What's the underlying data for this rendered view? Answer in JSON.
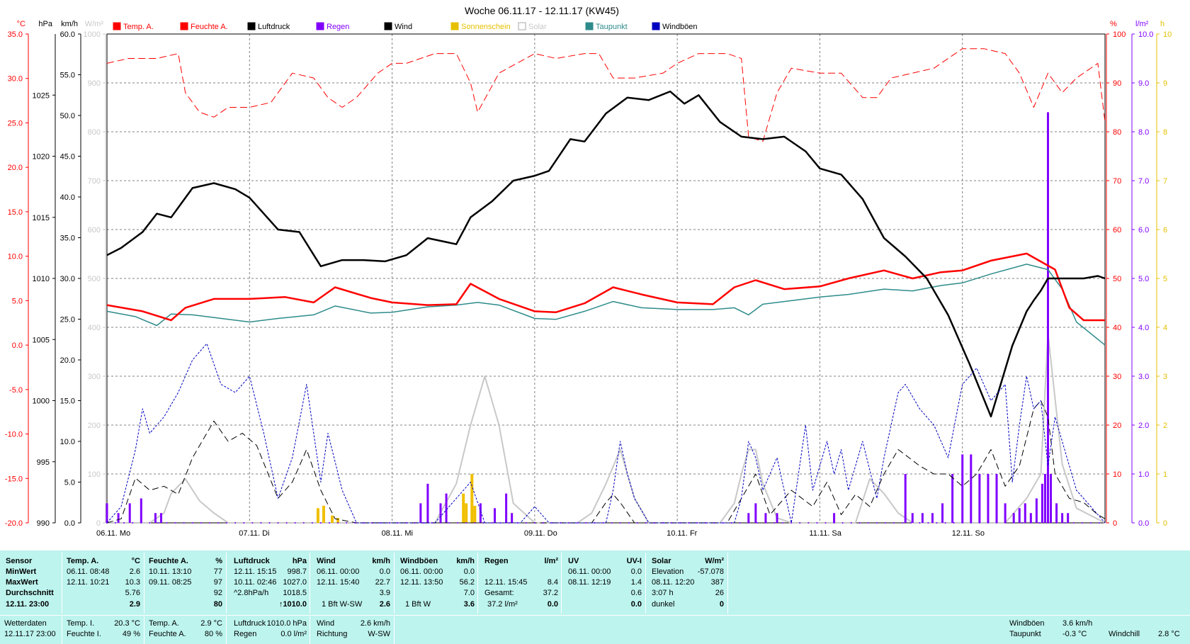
{
  "chart_data": {
    "type": "line",
    "title": "Woche 06.11.17 - 12.11.17 (KW45)",
    "x_days": [
      "06.11. Mo",
      "07.11. Di",
      "08.11. Mi",
      "09.11. Do",
      "10.11. Fr",
      "11.11. Sa",
      "12.11. So"
    ],
    "legend": [
      {
        "name": "Temp. A.",
        "color": "#ff0000"
      },
      {
        "name": "Feuchte A.",
        "color": "#ff0000"
      },
      {
        "name": "Luftdruck",
        "color": "#000000"
      },
      {
        "name": "Regen",
        "color": "#8000ff"
      },
      {
        "name": "Wind",
        "color": "#000000"
      },
      {
        "name": "Sonnenschein",
        "color": "#e6c000"
      },
      {
        "name": "Solar",
        "color": "#c8c8c8"
      },
      {
        "name": "Taupunkt",
        "color": "#2e8b8b"
      },
      {
        "name": "Windböen",
        "color": "#0000c0"
      }
    ],
    "axes": {
      "temp": {
        "unit": "°C",
        "min": -20,
        "max": 35,
        "ticks": [
          "35.0",
          "30.0",
          "25.0",
          "20.0",
          "15.0",
          "10.0",
          "5.0",
          "0.0",
          "-5.0",
          "-10.0",
          "-15.0",
          "-20.0"
        ]
      },
      "pressure": {
        "unit": "hPa",
        "min": 990,
        "max": 1030,
        "ticks": [
          "1025",
          "1020",
          "1015",
          "1010",
          "1005",
          "1000",
          "995",
          "990"
        ]
      },
      "wind": {
        "unit": "km/h",
        "min": 0,
        "max": 60,
        "ticks": [
          "60.0",
          "55.0",
          "50.0",
          "45.0",
          "40.0",
          "35.0",
          "30.0",
          "25.0",
          "20.0",
          "15.0",
          "10.0",
          "5.0",
          "0.0"
        ]
      },
      "solar": {
        "unit": "W/m²",
        "min": 0,
        "max": 1000,
        "ticks": [
          "1000",
          "900",
          "800",
          "700",
          "600",
          "500",
          "400",
          "300",
          "200",
          "100",
          "0"
        ]
      },
      "humidity": {
        "unit": "%",
        "min": 0,
        "max": 100,
        "ticks": [
          "100",
          "90",
          "80",
          "70",
          "60",
          "50",
          "40",
          "30",
          "20",
          "10",
          "0"
        ]
      },
      "rain": {
        "unit": "l/m²",
        "min": 0,
        "max": 10,
        "ticks": [
          "10.0",
          "9.0",
          "8.0",
          "7.0",
          "6.0",
          "5.0",
          "4.0",
          "3.0",
          "2.0",
          "1.0",
          "0.0"
        ]
      },
      "sun": {
        "unit": "h",
        "min": 0,
        "max": 10,
        "ticks": [
          "10",
          "9",
          "8",
          "7",
          "6",
          "5",
          "4",
          "3",
          "2",
          "1",
          "0"
        ]
      }
    },
    "series": [
      {
        "name": "Temp. A.",
        "axis": "temp",
        "x": [
          0,
          0.25,
          0.45,
          0.55,
          0.75,
          1,
          1.25,
          1.45,
          1.6,
          1.85,
          2,
          2.25,
          2.45,
          2.55,
          2.75,
          3,
          3.15,
          3.35,
          3.55,
          3.75,
          4,
          4.25,
          4.4,
          4.55,
          4.75,
          5,
          5.2,
          5.45,
          5.65,
          5.85,
          6,
          6.2,
          6.45,
          6.65,
          6.75,
          6.85,
          7
        ],
        "y": [
          4.5,
          3.8,
          2.8,
          4.2,
          5.2,
          5.2,
          5.4,
          4.8,
          6.5,
          5.3,
          4.8,
          4.5,
          4.6,
          6.9,
          5.2,
          3.8,
          3.7,
          4.7,
          6.5,
          5.7,
          4.8,
          4.6,
          6.5,
          7.3,
          6.3,
          6.6,
          7.5,
          8.4,
          7.5,
          8.2,
          8.4,
          9.5,
          10.3,
          8.5,
          4.2,
          2.8,
          2.8
        ]
      },
      {
        "name": "Taupunkt",
        "axis": "temp",
        "x": [
          0,
          0.2,
          0.35,
          0.45,
          0.6,
          1,
          1.2,
          1.45,
          1.6,
          1.85,
          2,
          2.25,
          2.45,
          2.6,
          2.75,
          3,
          3.15,
          3.35,
          3.55,
          3.75,
          4,
          4.25,
          4.4,
          4.5,
          4.6,
          5,
          5.2,
          5.45,
          5.65,
          5.85,
          6,
          6.2,
          6.45,
          6.6,
          6.7,
          6.8,
          7
        ],
        "y": [
          3.8,
          3.2,
          2.2,
          3.5,
          3.4,
          2.6,
          3.0,
          3.4,
          4.4,
          3.6,
          3.7,
          4.3,
          4.5,
          4.8,
          4.5,
          3.0,
          2.9,
          3.8,
          4.9,
          4.2,
          4.0,
          4.0,
          4.2,
          3.4,
          4.6,
          5.4,
          5.7,
          6.3,
          6.1,
          6.7,
          7.0,
          8.0,
          9.1,
          8.5,
          6.3,
          2.6,
          0.0
        ]
      },
      {
        "name": "Feuchte A.",
        "axis": "humidity",
        "x": [
          0,
          0.15,
          0.35,
          0.5,
          0.55,
          0.65,
          0.75,
          0.85,
          1,
          1.15,
          1.3,
          1.45,
          1.55,
          1.65,
          1.75,
          1.9,
          2,
          2.1,
          2.3,
          2.45,
          2.55,
          2.6,
          2.75,
          3,
          3.15,
          3.35,
          3.45,
          3.55,
          3.7,
          3.9,
          4,
          4.15,
          4.35,
          4.45,
          4.5,
          4.6,
          4.7,
          4.8,
          5,
          5.15,
          5.3,
          5.4,
          5.5,
          5.65,
          5.8,
          6,
          6.15,
          6.3,
          6.4,
          6.5,
          6.6,
          6.7,
          6.8,
          6.95,
          7
        ],
        "y": [
          94,
          95,
          95,
          96,
          88,
          84,
          83,
          85,
          85,
          86,
          92,
          91,
          87,
          85,
          87,
          92,
          94,
          94,
          96,
          96,
          90,
          84,
          92,
          96,
          95,
          96,
          96,
          91,
          91,
          92,
          94,
          96,
          96,
          95,
          79,
          78,
          88,
          93,
          92,
          92,
          87,
          87,
          91,
          92,
          93,
          97,
          97,
          96,
          92,
          85,
          92,
          88,
          91,
          94,
          82
        ]
      },
      {
        "name": "Luftdruck",
        "axis": "pressure",
        "x": [
          0,
          0.1,
          0.25,
          0.35,
          0.45,
          0.6,
          0.75,
          0.9,
          1,
          1.2,
          1.35,
          1.5,
          1.65,
          1.8,
          1.95,
          2.1,
          2.25,
          2.45,
          2.55,
          2.7,
          2.85,
          3,
          3.1,
          3.25,
          3.35,
          3.5,
          3.65,
          3.8,
          3.95,
          4.05,
          4.15,
          4.3,
          4.45,
          4.6,
          4.75,
          4.9,
          5,
          5.15,
          5.3,
          5.45,
          5.6,
          5.75,
          5.9,
          6.05,
          6.2,
          6.35,
          6.45,
          6.5,
          6.55,
          6.6,
          6.7,
          6.85,
          6.95,
          7
        ],
        "y": [
          1011.9,
          1012.5,
          1013.8,
          1015.3,
          1015.0,
          1017.4,
          1017.8,
          1017.3,
          1016.6,
          1014.0,
          1013.8,
          1011.0,
          1011.5,
          1011.5,
          1011.4,
          1011.9,
          1013.3,
          1012.8,
          1015.0,
          1016.3,
          1018.0,
          1018.4,
          1018.8,
          1021.4,
          1021.2,
          1023.5,
          1024.8,
          1024.6,
          1025.3,
          1024.3,
          1025.0,
          1022.8,
          1021.6,
          1021.4,
          1021.6,
          1020.4,
          1019.0,
          1018.5,
          1016.5,
          1013.3,
          1011.8,
          1010.0,
          1007.0,
          1003.0,
          998.7,
          1004.5,
          1007.3,
          1008.2,
          1009.0,
          1010.0,
          1010.0,
          1010.0,
          1010.2,
          1010.0
        ],
        "note": "approximate"
      },
      {
        "name": "Wind",
        "axis": "wind",
        "x": [
          0,
          0.1,
          0.2,
          0.3,
          0.4,
          0.5,
          0.6,
          0.75,
          0.85,
          0.95,
          1.05,
          1.2,
          1.3,
          1.4,
          1.5,
          1.6,
          1.75,
          1.9,
          2,
          2.1,
          2.3,
          2.45,
          2.6,
          2.75,
          2.9,
          3.0,
          3.1,
          3.2,
          3.4,
          3.5,
          3.55,
          3.6,
          3.7,
          3.8,
          3.9,
          4,
          4.2,
          4.35,
          4.45,
          4.55,
          4.65,
          4.8,
          4.95,
          5.05,
          5.15,
          5.25,
          5.35,
          5.45,
          5.55,
          5.7,
          5.8,
          5.9,
          6,
          6.1,
          6.2,
          6.3,
          6.4,
          6.45,
          6.5,
          6.55,
          6.6,
          6.65,
          6.75,
          6.85,
          6.95,
          7
        ],
        "y": [
          0,
          0.5,
          5.5,
          4,
          4.5,
          3.5,
          8,
          12.5,
          10,
          11,
          9.5,
          3,
          5,
          9,
          4,
          0.5,
          0,
          0,
          0,
          0,
          0,
          0,
          0,
          0,
          0,
          0,
          0,
          0,
          0,
          2.5,
          3.5,
          2.5,
          0,
          0,
          0,
          0,
          0,
          0,
          3,
          6,
          1,
          4,
          2,
          5,
          1,
          3.5,
          2,
          6,
          9,
          7,
          6,
          6,
          4.5,
          6,
          9,
          4.5,
          7,
          10.5,
          14,
          15,
          13,
          6,
          3,
          2.5,
          1,
          0.5
        ]
      },
      {
        "name": "Windböen",
        "axis": "wind",
        "x": [
          0,
          0.1,
          0.2,
          0.25,
          0.3,
          0.4,
          0.5,
          0.6,
          0.7,
          0.8,
          0.9,
          1,
          1.1,
          1.2,
          1.3,
          1.4,
          1.5,
          1.55,
          1.65,
          1.75,
          1.9,
          2,
          2.3,
          2.45,
          2.55,
          2.65,
          2.75,
          2.9,
          3,
          3.1,
          3.3,
          3.4,
          3.5,
          3.55,
          3.6,
          3.65,
          3.7,
          3.8,
          4,
          4.3,
          4.4,
          4.45,
          4.5,
          4.55,
          4.6,
          4.7,
          4.8,
          4.9,
          4.95,
          5.05,
          5.1,
          5.15,
          5.2,
          5.3,
          5.4,
          5.45,
          5.55,
          5.6,
          5.7,
          5.8,
          5.9,
          6,
          6.1,
          6.2,
          6.3,
          6.35,
          6.4,
          6.45,
          6.5,
          6.55,
          6.6,
          6.65,
          6.7,
          6.8,
          6.9,
          7
        ],
        "y": [
          0,
          2,
          9,
          14,
          11,
          13,
          16,
          20,
          22,
          17,
          16,
          18,
          11,
          3,
          8,
          17,
          5,
          11,
          4,
          0,
          0,
          0,
          0,
          3,
          5,
          0,
          0,
          0,
          2,
          0,
          0,
          0,
          0,
          4,
          10,
          6,
          3,
          0,
          0,
          0,
          0,
          3,
          10,
          8,
          4,
          8,
          0,
          12,
          4,
          10,
          6,
          9,
          4,
          10,
          3,
          8,
          16,
          17,
          14,
          12,
          8,
          17,
          19,
          15,
          17,
          5,
          12,
          18,
          14,
          15,
          7,
          13,
          10,
          4,
          2,
          0
        ]
      },
      {
        "name": "Solar",
        "axis": "solar",
        "x": [
          0,
          0.3,
          0.4,
          0.45,
          0.55,
          0.65,
          0.75,
          0.85,
          1.0,
          2.3,
          2.45,
          2.55,
          2.65,
          2.75,
          2.85,
          3.0,
          3.3,
          3.4,
          3.5,
          3.6,
          3.7,
          3.8,
          4.0,
          4.3,
          4.4,
          4.45,
          4.5,
          4.55,
          4.6,
          4.7,
          4.8,
          5.0,
          5.25,
          5.35,
          5.45,
          5.55,
          5.65,
          5.8,
          6.0,
          6.2,
          6.3,
          6.45,
          6.55,
          6.6,
          6.7,
          6.8,
          7
        ],
        "y": [
          0,
          0,
          20,
          60,
          90,
          45,
          20,
          0,
          0,
          0,
          80,
          200,
          300,
          200,
          40,
          0,
          0,
          20,
          80,
          150,
          50,
          0,
          0,
          0,
          40,
          100,
          150,
          150,
          80,
          10,
          0,
          0,
          0,
          90,
          60,
          20,
          0,
          0,
          0,
          0,
          0,
          50,
          100,
          387,
          120,
          30,
          0
        ]
      },
      {
        "name": "Regen",
        "axis": "rain",
        "type": "bar",
        "x": [
          0.0,
          0.08,
          0.16,
          0.24,
          0.34,
          0.38,
          2.2,
          2.25,
          2.34,
          2.38,
          2.62,
          2.72,
          2.8,
          2.84,
          4.5,
          4.55,
          4.62,
          4.7,
          5.1,
          5.6,
          5.65,
          5.72,
          5.79,
          5.86,
          5.93,
          6.0,
          6.06,
          6.12,
          6.18,
          6.24,
          6.3,
          6.36,
          6.4,
          6.44,
          6.48,
          6.52,
          6.56,
          6.58,
          6.6,
          6.62,
          6.66,
          6.7,
          6.74
        ],
        "y": [
          0.4,
          0.2,
          0.4,
          0.5,
          0.2,
          0.2,
          0.4,
          0.8,
          0.4,
          0.6,
          0.4,
          0.3,
          0.6,
          0.2,
          0.2,
          0.4,
          0.2,
          0.2,
          0.2,
          1.0,
          0.2,
          0.2,
          0.2,
          0.4,
          1.0,
          1.4,
          1.4,
          1.0,
          1.0,
          1.0,
          0.4,
          0.2,
          0.3,
          0.4,
          0.2,
          0.5,
          0.8,
          1.0,
          8.4,
          1.0,
          0.4,
          0.2,
          0.2
        ]
      },
      {
        "name": "Sonnenschein",
        "axis": "sun",
        "type": "bar",
        "x": [
          1.48,
          1.52,
          1.58,
          1.62,
          2.5,
          2.52,
          2.56,
          2.58
        ],
        "y": [
          0.3,
          0.35,
          0.15,
          0.1,
          0.6,
          0.4,
          1.0,
          0.35
        ]
      }
    ]
  },
  "stats": {
    "headers": {
      "sensor": "Sensor",
      "temp": "Temp. A.",
      "temp_unit": "°C",
      "hum": "Feuchte A.",
      "hum_unit": "%",
      "press": "Luftdruck",
      "press_unit": "hPa",
      "wind": "Wind",
      "wind_unit": "km/h",
      "gust": "Windböen",
      "gust_unit": "km/h",
      "rain": "Regen",
      "rain_unit": "l/m²",
      "uv": "UV",
      "uv_unit": "UV-I",
      "solar": "Solar",
      "solar_unit": "W/m²"
    },
    "rows": {
      "min": "MinWert",
      "max": "MaxWert",
      "avg": "Durchschnitt",
      "last": "12.11.  23:00"
    },
    "temp": {
      "min_t": "06.11.  08:48",
      "min_v": "2.6",
      "max_t": "12.11.  10:21",
      "max_v": "10.3",
      "avg_v": "5.76",
      "last_v": "2.9"
    },
    "hum": {
      "min_t": "10.11.  13:10",
      "min_v": "77",
      "max_t": "09.11.  08:25",
      "max_v": "97",
      "avg_v": "92",
      "last_v": "80"
    },
    "press": {
      "min_t": "12.11.  15:15",
      "min_v": "998.7",
      "max_t": "10.11.  02:46",
      "max_v": "1027.0",
      "avg_t": "^2.8hPa/h",
      "avg_v": "1018.5",
      "last_v": "↑1010.0"
    },
    "wind": {
      "min_t": "06.11.  00:00",
      "min_v": "0.0",
      "max_t": "12.11.  15:40",
      "max_v": "22.7",
      "avg_v": "3.9",
      "last_t": "1 Bft W-SW",
      "last_v": "2.6"
    },
    "gust": {
      "min_t": "06.11.  00:00",
      "min_v": "0.0",
      "max_t": "12.11.  13:50",
      "max_v": "56.2",
      "avg_v": "7.0",
      "last_t": "1 Bft W",
      "last_v": "3.6"
    },
    "rain": {
      "max_t": "12.11.  15:45",
      "max_v": "8.4",
      "total_label": "Gesamt:",
      "total_v": "37.2",
      "last_t": "37.2 l/m²",
      "last_v": "0.0"
    },
    "uv": {
      "min_t": "06.11.  00:00",
      "min_v": "0.0",
      "max_t": "08.11.  12:19",
      "max_v": "1.4",
      "avg_v": "0.6",
      "last_v": "0.0"
    },
    "solar": {
      "r1_l": "Elevation",
      "r1_v": "-57.078",
      "r2_l": "08.11.  12:20",
      "r2_v": "387",
      "r3_l": "3:07 h",
      "r3_v": "26",
      "r4_l": "dunkel",
      "r4_v": "0"
    }
  },
  "current": {
    "wetterdaten": "Wetterdaten",
    "stamp": "12.11.17 23:00",
    "temp_i_l": "Temp. I.",
    "temp_i_v": "20.3 °C",
    "feuchte_i_l": "Feuchte I.",
    "feuchte_i_v": "49 %",
    "temp_a_l": "Temp. A.",
    "temp_a_v": "2.9 °C",
    "feuchte_a_l": "Feuchte A.",
    "feuchte_a_v": "80 %",
    "luftdruck_l": "Luftdruck",
    "luftdruck_v": "1010.0 hPa",
    "regen_l": "Regen",
    "regen_v": "0.0 l/m²",
    "wind_l": "Wind",
    "wind_v": "2.6 km/h",
    "richtung_l": "Richtung",
    "richtung_v": "W-SW",
    "windboeen_l": "Windböen",
    "windboeen_v": "3.6 km/h",
    "taupunkt_l": "Taupunkt",
    "taupunkt_v": "-0.3 °C",
    "windchill_l": "Windchill",
    "windchill_v": "2.8 °C"
  }
}
